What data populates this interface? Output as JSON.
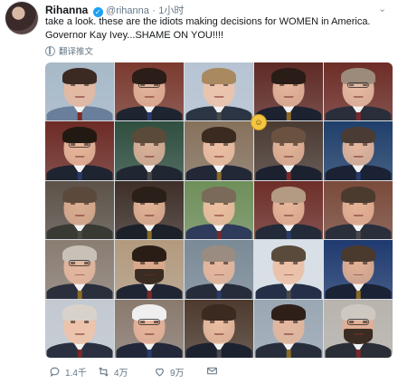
{
  "tweet": {
    "author_name": "Rihanna",
    "handle": "@rihanna",
    "separator": "·",
    "time": "1小时",
    "text_line1": "take a look. these are the idiots making decisions for WOMEN in America.",
    "text_line2": "Governor Kay Ivey...SHAME ON YOU!!!!",
    "translate_label": "翻译推文"
  },
  "photo_grid": {
    "rows": 5,
    "cols": 5,
    "cells": [
      {
        "bg": "#a7b9c8",
        "skin": "#e6b9a0",
        "hair": "#3b2a22",
        "suit": "#6a7f9c",
        "glasses": false
      },
      {
        "bg": "#7b3a2f",
        "skin": "#e4b59b",
        "hair": "#2b1d17",
        "suit": "#1f2530",
        "glasses": true
      },
      {
        "bg": "#b7c4d3",
        "skin": "#eec3ab",
        "hair": "#a9895f",
        "suit": "#2c3544",
        "glasses": false
      },
      {
        "bg": "#5f2a25",
        "skin": "#e7b79d",
        "hair": "#2a1c16",
        "suit": "#1c2230",
        "glasses": false
      },
      {
        "bg": "#6e2d27",
        "skin": "#e8bda5",
        "hair": "#9c8a7a",
        "suit": "#2a2e3a",
        "glasses": true
      },
      {
        "bg": "#6d2b24",
        "skin": "#e9b99d",
        "hair": "#231913",
        "suit": "#1e2430",
        "glasses": true
      },
      {
        "bg": "#2f4f3f",
        "skin": "#ddb29a",
        "hair": "#5a4a3a",
        "suit": "#202632",
        "glasses": false
      },
      {
        "bg": "#86715c",
        "skin": "#edc0a4",
        "hair": "#3a2a20",
        "suit": "#232836",
        "glasses": false
      },
      {
        "bg": "#4a3a32",
        "skin": "#e5b59a",
        "hair": "#6b5240",
        "suit": "#1c2130",
        "glasses": false
      },
      {
        "bg": "#1f3f6b",
        "skin": "#e6b89e",
        "hair": "#4a3c34",
        "suit": "#1b2234",
        "glasses": false
      },
      {
        "bg": "#5c5248",
        "skin": "#ddae92",
        "hair": "#5b4a3b",
        "suit": "#3a3a34",
        "glasses": false
      },
      {
        "bg": "#3e2f28",
        "skin": "#e5b497",
        "hair": "#2b1f19",
        "suit": "#1c2029",
        "glasses": false
      },
      {
        "bg": "#6f8f5a",
        "skin": "#eebfa1",
        "hair": "#7a6a5a",
        "suit": "#2e3b5a",
        "glasses": false
      },
      {
        "bg": "#6e2e28",
        "skin": "#e8b89c",
        "hair": "#b39a82",
        "suit": "#232a38",
        "glasses": false
      },
      {
        "bg": "#7a4a3a",
        "skin": "#e6b397",
        "hair": "#4b3a2e",
        "suit": "#2a2f3b",
        "glasses": false
      },
      {
        "bg": "#8a7d72",
        "skin": "#e7b9a0",
        "hair": "#c8c1b8",
        "suit": "#2a2f3c",
        "glasses": true
      },
      {
        "bg": "#b39a7e",
        "skin": "#dca98c",
        "hair": "#2a1d16",
        "suit": "#202534",
        "glasses": false,
        "beard": true
      },
      {
        "bg": "#7a8a96",
        "skin": "#e8b89d",
        "hair": "#9a8c80",
        "suit": "#262c3a",
        "glasses": false
      },
      {
        "bg": "#d9dfe6",
        "skin": "#ecbfa5",
        "hair": "#5a4a3c",
        "suit": "#253048",
        "glasses": false
      },
      {
        "bg": "#1f3a6f",
        "skin": "#e4b295",
        "hair": "#4a3a2e",
        "suit": "#1a2236",
        "glasses": false
      },
      {
        "bg": "#c3c9d1",
        "skin": "#efc3a9",
        "hair": "#d8d2cb",
        "suit": "#2a3040",
        "glasses": false
      },
      {
        "bg": "#8a7a6e",
        "skin": "#e8b49a",
        "hair": "#efefef",
        "suit": "#22283a",
        "glasses": true
      },
      {
        "bg": "#4e3a2e",
        "skin": "#edbfa3",
        "hair": "#3a2a20",
        "suit": "#1d2231",
        "glasses": false
      },
      {
        "bg": "#9aa7b3",
        "skin": "#e5b79d",
        "hair": "#2e2019",
        "suit": "#272d3b",
        "glasses": false
      },
      {
        "bg": "#b8b3ad",
        "skin": "#e2ae94",
        "hair": "#cfc8c0",
        "suit": "#2a2e36",
        "glasses": true,
        "beard": true
      }
    ]
  },
  "actions": {
    "reply_count": "1.4千",
    "retweet_count": "4万",
    "like_count": "9万"
  },
  "colors": {
    "verified": "#1da1f2",
    "muted_text": "#657786"
  }
}
